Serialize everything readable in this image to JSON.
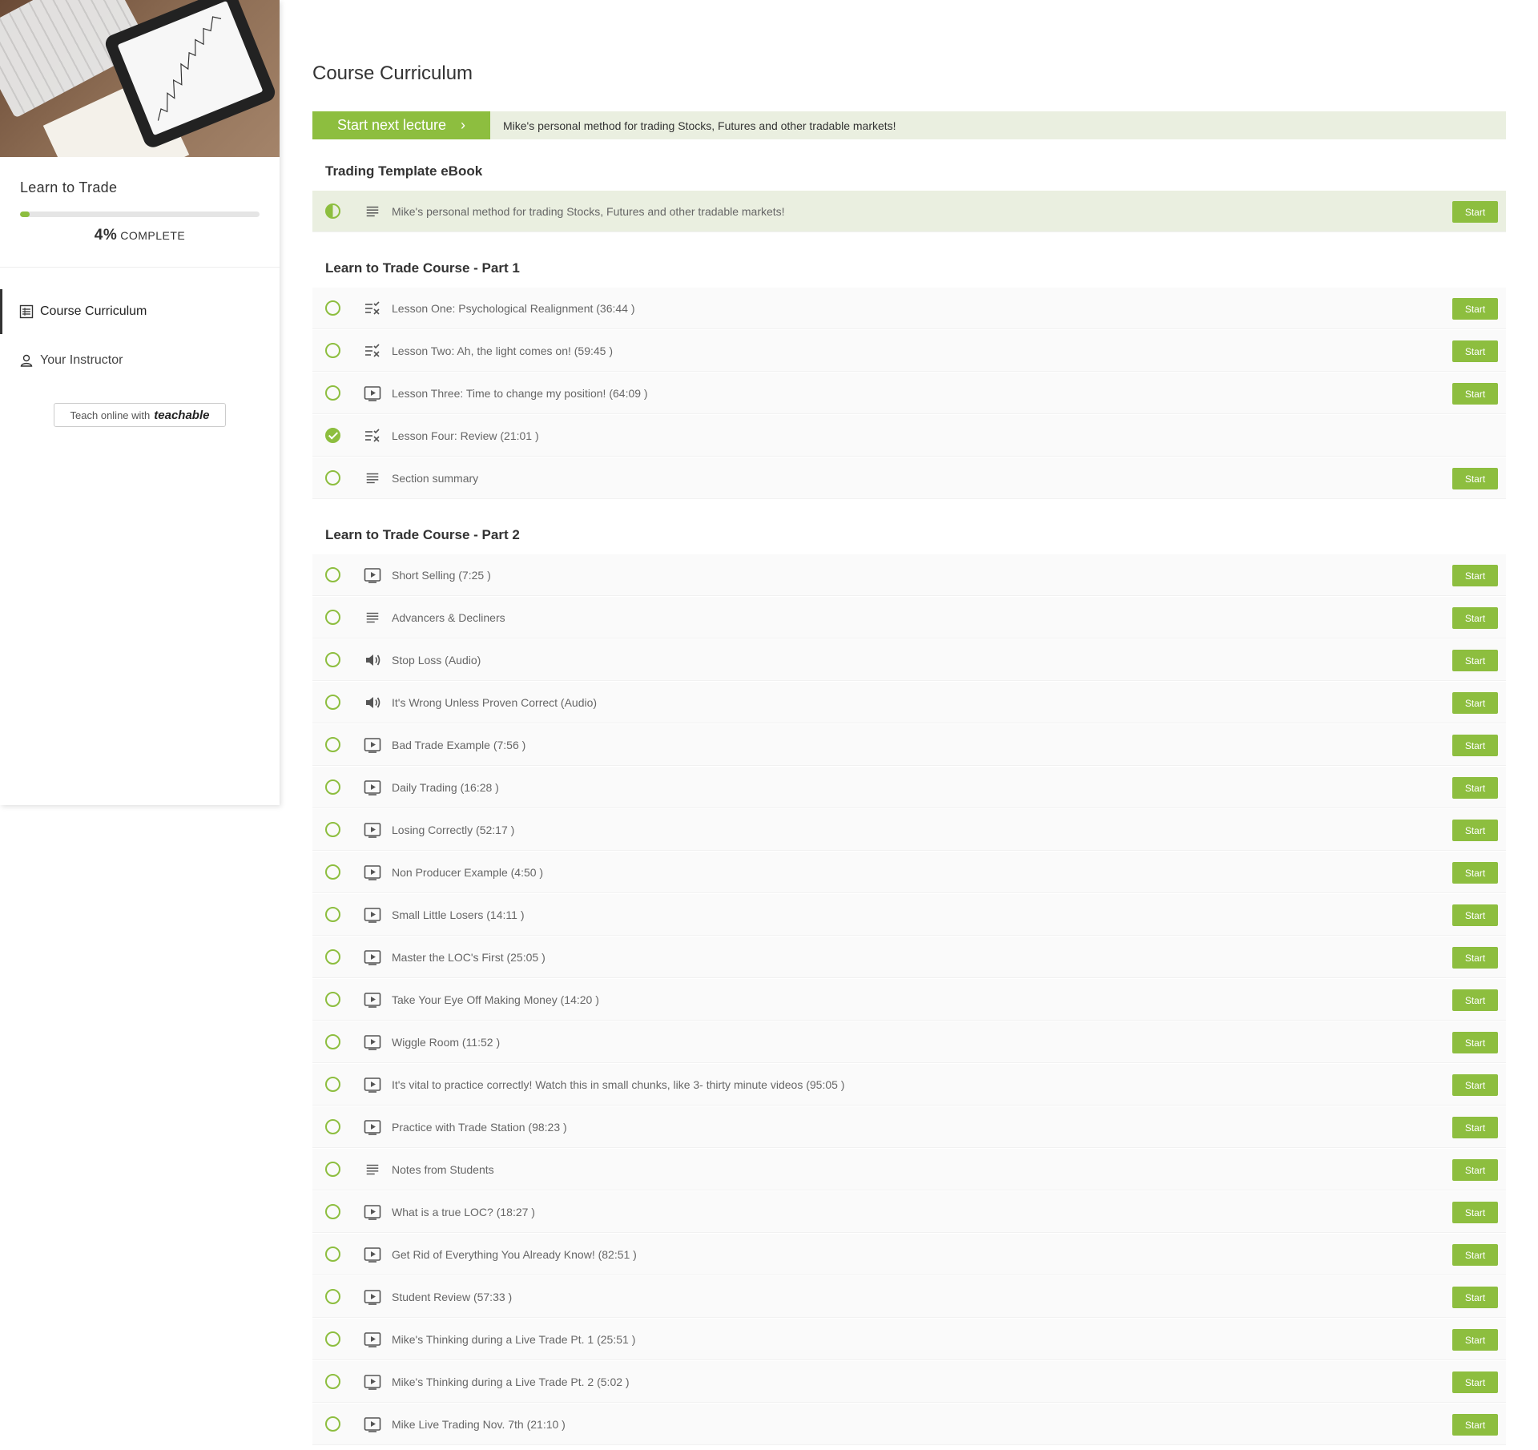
{
  "sidebar": {
    "course_title": "Learn to Trade",
    "progress_percent": 4,
    "progress_pct_text": "4%",
    "progress_label": "COMPLETE",
    "nav": [
      {
        "label": "Course Curriculum",
        "icon": "list-icon",
        "active": true
      },
      {
        "label": "Your Instructor",
        "icon": "user-icon",
        "active": false
      }
    ],
    "teach_badge": {
      "prefix": "Teach online with",
      "brand": "teachable"
    }
  },
  "main": {
    "title": "Course Curriculum",
    "next_lecture": {
      "button_label": "Start next lecture",
      "description": "Mike's personal method for trading Stocks, Futures and other tradable markets!"
    },
    "start_label": "Start",
    "colors": {
      "accent": "#8dbe3f",
      "highlight": "#eaefe0"
    },
    "sections": [
      {
        "title": "Trading Template eBook",
        "lessons": [
          {
            "title": "Mike's personal method for trading Stocks, Futures and other tradable markets!",
            "type": "text",
            "status": "half",
            "start": true,
            "highlight": true
          }
        ]
      },
      {
        "title": "Learn to Trade Course - Part 1",
        "lessons": [
          {
            "title": "Lesson One: Psychological Realignment (36:44 )",
            "type": "quiz",
            "status": "none",
            "start": true
          },
          {
            "title": "Lesson Two: Ah, the light comes on! (59:45 )",
            "type": "quiz",
            "status": "none",
            "start": true
          },
          {
            "title": "Lesson Three: Time to change my position! (64:09 )",
            "type": "video",
            "status": "none",
            "start": true
          },
          {
            "title": "Lesson Four: Review (21:01 )",
            "type": "quiz",
            "status": "done",
            "start": false
          },
          {
            "title": "Section summary",
            "type": "text",
            "status": "none",
            "start": true
          }
        ]
      },
      {
        "title": "Learn to Trade Course - Part 2",
        "lessons": [
          {
            "title": "Short Selling (7:25 )",
            "type": "video",
            "status": "none",
            "start": true
          },
          {
            "title": "Advancers & Decliners",
            "type": "text",
            "status": "none",
            "start": true
          },
          {
            "title": "Stop Loss (Audio)",
            "type": "audio",
            "status": "none",
            "start": true
          },
          {
            "title": "It's Wrong Unless Proven Correct (Audio)",
            "type": "audio",
            "status": "none",
            "start": true
          },
          {
            "title": "Bad Trade Example (7:56 )",
            "type": "video",
            "status": "none",
            "start": true
          },
          {
            "title": "Daily Trading (16:28 )",
            "type": "video",
            "status": "none",
            "start": true
          },
          {
            "title": "Losing Correctly (52:17 )",
            "type": "video",
            "status": "none",
            "start": true
          },
          {
            "title": "Non Producer Example (4:50 )",
            "type": "video",
            "status": "none",
            "start": true
          },
          {
            "title": "Small Little Losers (14:11 )",
            "type": "video",
            "status": "none",
            "start": true
          },
          {
            "title": "Master the LOC's First (25:05 )",
            "type": "video",
            "status": "none",
            "start": true
          },
          {
            "title": "Take Your Eye Off Making Money (14:20 )",
            "type": "video",
            "status": "none",
            "start": true
          },
          {
            "title": "Wiggle Room (11:52 )",
            "type": "video",
            "status": "none",
            "start": true
          },
          {
            "title": "It's vital to practice correctly! Watch this in small chunks, like 3- thirty minute videos (95:05 )",
            "type": "video",
            "status": "none",
            "start": true
          },
          {
            "title": "Practice with Trade Station (98:23 )",
            "type": "video",
            "status": "none",
            "start": true
          },
          {
            "title": "Notes from Students",
            "type": "text",
            "status": "none",
            "start": true
          },
          {
            "title": "What is a true LOC? (18:27 )",
            "type": "video",
            "status": "none",
            "start": true
          },
          {
            "title": "Get Rid of Everything You Already Know! (82:51 )",
            "type": "video",
            "status": "none",
            "start": true
          },
          {
            "title": "Student Review (57:33 )",
            "type": "video",
            "status": "none",
            "start": true
          },
          {
            "title": "Mike's Thinking during a Live Trade Pt. 1 (25:51 )",
            "type": "video",
            "status": "none",
            "start": true
          },
          {
            "title": "Mike's Thinking during a Live Trade Pt. 2 (5:02 )",
            "type": "video",
            "status": "none",
            "start": true
          },
          {
            "title": "Mike Live Trading Nov. 7th (21:10 )",
            "type": "video",
            "status": "none",
            "start": true
          }
        ]
      }
    ]
  }
}
